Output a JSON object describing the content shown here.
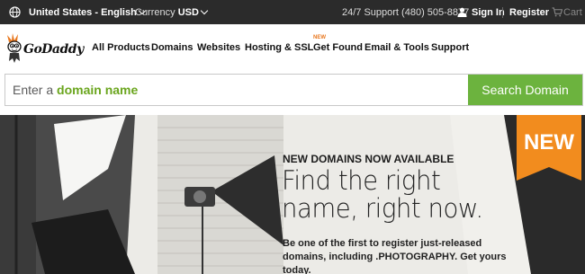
{
  "topbar": {
    "language": "United States - English",
    "currency_label": "Currency",
    "currency_value": "USD",
    "support": "24/7 Support (480) 505-8877",
    "signin": "Sign In",
    "register": "Register",
    "cart": "Cart"
  },
  "header": {
    "logo_text": "GoDaddy",
    "nav": [
      {
        "label": "All Products"
      },
      {
        "label": "Domains"
      },
      {
        "label": "Websites"
      },
      {
        "label": "Hosting & SSL"
      },
      {
        "label": "Get Found",
        "badge": "NEW"
      },
      {
        "label": "Email & Tools"
      },
      {
        "label": "Support"
      }
    ]
  },
  "search": {
    "placeholder_prefix": "Enter a ",
    "placeholder_bold": "domain name",
    "button": "Search Domain"
  },
  "hero": {
    "kicker": "NEW DOMAINS NOW AVAILABLE",
    "headline_line1": "Find the right",
    "headline_line2": "name, right now.",
    "body": "Be one of the first to register just-released domains, including .PHOTOGRAPHY. Get yours today.",
    "badge": "NEW"
  },
  "colors": {
    "topbar_bg": "#2b2b2b",
    "accent_green": "#6cb33e",
    "badge_orange": "#f28c1e"
  }
}
